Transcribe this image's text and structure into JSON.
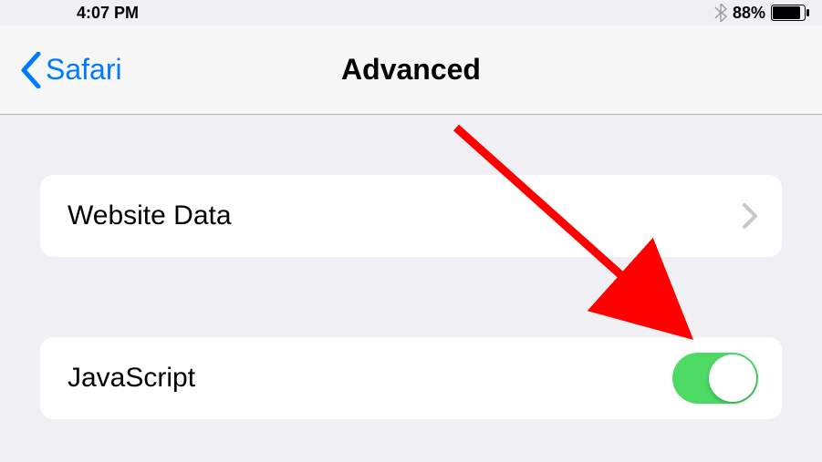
{
  "status": {
    "time": "4:07 PM",
    "battery_pct": "88%"
  },
  "nav": {
    "back_label": "Safari",
    "title": "Advanced"
  },
  "rows": {
    "website_data": "Website Data",
    "javascript": "JavaScript",
    "javascript_on": true
  }
}
